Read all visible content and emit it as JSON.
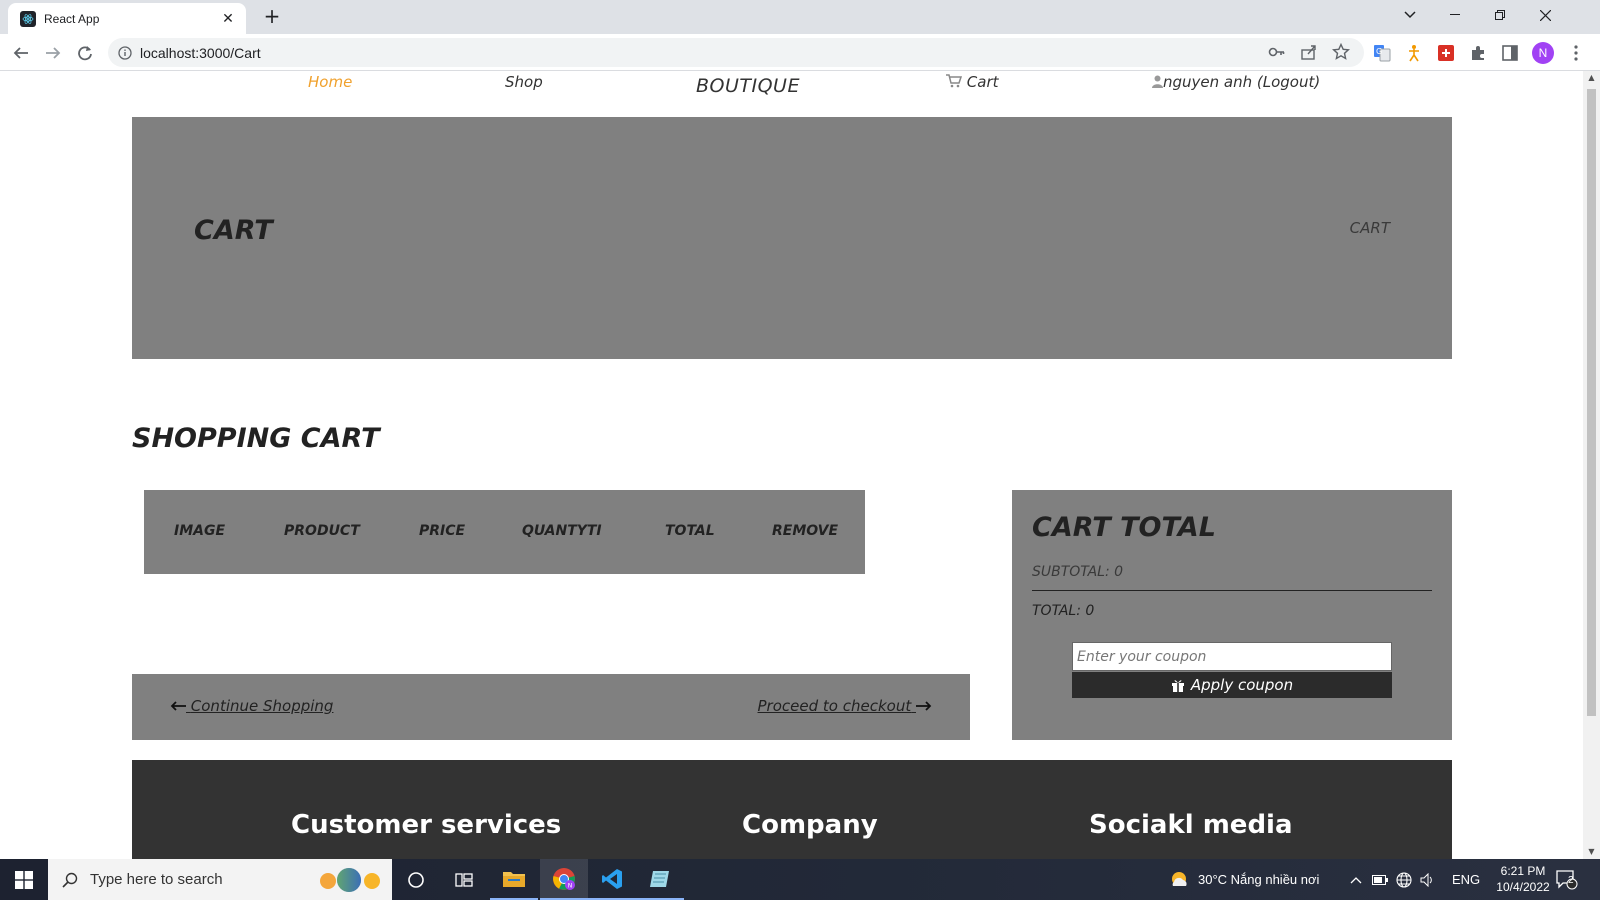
{
  "browser": {
    "tab_title": "React App",
    "url": "localhost:3000/Cart"
  },
  "nav": {
    "home": "Home",
    "shop": "Shop",
    "brand": "BOUTIQUE",
    "cart": "Cart",
    "user": "nguyen anh (Logout)"
  },
  "hero": {
    "title": "CART",
    "breadcrumb": "CART"
  },
  "section_title": "SHOPPING CART",
  "table_headers": [
    "IMAGE",
    "PRODUCT",
    "PRICE",
    "QUANTYTI",
    "TOTAL",
    "REMOVE"
  ],
  "actions": {
    "continue": "Continue Shopping",
    "checkout": "Proceed to checkout"
  },
  "cart_total": {
    "title": "CART TOTAL",
    "subtotal": "SUBTOTAL: 0",
    "total": "TOTAL: 0",
    "coupon_placeholder": "Enter your coupon",
    "coupon_button": "Apply coupon"
  },
  "footer": {
    "col1": "Customer services",
    "col2": "Company",
    "col3": "Sociakl media"
  },
  "taskbar": {
    "search_placeholder": "Type here to search",
    "weather": "30°C  Nắng nhiều nơi",
    "language": "ENG",
    "time": "6:21 PM",
    "date": "10/4/2022",
    "notifications": "2"
  },
  "colors": {
    "active_nav": "#f0a12d",
    "panel_gray": "#808080",
    "footer_dark": "#333333"
  }
}
